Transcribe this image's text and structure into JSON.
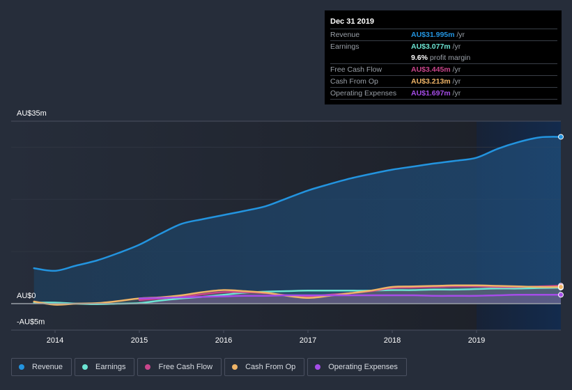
{
  "tooltip": {
    "date": "Dec 31 2019",
    "rows": [
      {
        "label": "Revenue",
        "value": "AU$31.995m",
        "unit": " /yr",
        "color": "#2394df"
      },
      {
        "label": "Earnings",
        "value": "AU$3.077m",
        "unit": " /yr",
        "color": "#6ce5d3"
      },
      {
        "label": "",
        "value": "9.6%",
        "unit": " profit margin",
        "color": "#ffffff"
      },
      {
        "label": "Free Cash Flow",
        "value": "AU$3.445m",
        "unit": " /yr",
        "color": "#c9458b"
      },
      {
        "label": "Cash From Op",
        "value": "AU$3.213m",
        "unit": " /yr",
        "color": "#efb467"
      },
      {
        "label": "Operating Expenses",
        "value": "AU$1.697m",
        "unit": " /yr",
        "color": "#a54de8"
      }
    ]
  },
  "legend": [
    {
      "label": "Revenue",
      "color": "#2394df"
    },
    {
      "label": "Earnings",
      "color": "#6ce5d3"
    },
    {
      "label": "Free Cash Flow",
      "color": "#c9458b"
    },
    {
      "label": "Cash From Op",
      "color": "#efb467"
    },
    {
      "label": "Operating Expenses",
      "color": "#a54de8"
    }
  ],
  "chart_data": {
    "type": "line",
    "title": "",
    "xlabel": "",
    "ylabel": "",
    "y_tick_labels": [
      "AU$35m",
      "AU$0",
      "-AU$5m"
    ],
    "y_ticks": [
      35,
      0,
      -5
    ],
    "ylim": [
      -5,
      35
    ],
    "x_tick_labels": [
      "2014",
      "2015",
      "2016",
      "2017",
      "2018",
      "2019"
    ],
    "x_ticks": [
      2014,
      2015,
      2016,
      2017,
      2018,
      2019
    ],
    "xlim": [
      2013.5,
      2020.0
    ],
    "grid": true,
    "highlight_from": 2019.0,
    "highlight_to": 2020.0,
    "series": [
      {
        "name": "Revenue",
        "color": "#2394df",
        "x": [
          2013.75,
          2014.0,
          2014.25,
          2014.5,
          2014.75,
          2015.0,
          2015.25,
          2015.5,
          2015.75,
          2016.0,
          2016.25,
          2016.5,
          2016.75,
          2017.0,
          2017.25,
          2017.5,
          2017.75,
          2018.0,
          2018.25,
          2018.5,
          2018.75,
          2019.0,
          2019.25,
          2019.5,
          2019.75,
          2020.0
        ],
        "values": [
          6.8,
          6.3,
          7.3,
          8.3,
          9.7,
          11.3,
          13.4,
          15.3,
          16.2,
          17.0,
          17.8,
          18.7,
          20.2,
          21.7,
          22.9,
          24.0,
          24.9,
          25.7,
          26.3,
          26.9,
          27.4,
          28.0,
          29.7,
          31.0,
          31.9,
          32.0
        ]
      },
      {
        "name": "Earnings",
        "color": "#6ce5d3",
        "x": [
          2013.75,
          2014.0,
          2014.25,
          2014.5,
          2014.75,
          2015.0,
          2015.25,
          2015.5,
          2015.75,
          2016.0,
          2016.25,
          2016.5,
          2016.75,
          2017.0,
          2017.25,
          2017.5,
          2017.75,
          2018.0,
          2018.25,
          2018.5,
          2018.75,
          2019.0,
          2019.25,
          2019.5,
          2019.75,
          2020.0
        ],
        "values": [
          0.2,
          0.2,
          0.0,
          -0.1,
          0.0,
          0.1,
          0.6,
          1.0,
          1.3,
          1.7,
          2.1,
          2.3,
          2.4,
          2.5,
          2.5,
          2.5,
          2.5,
          2.6,
          2.6,
          2.7,
          2.7,
          2.8,
          2.9,
          2.9,
          3.0,
          3.077
        ]
      },
      {
        "name": "Free Cash Flow",
        "color": "#c9458b",
        "x": [
          2015.0,
          2015.25,
          2015.5,
          2015.75,
          2016.0,
          2016.25,
          2016.5,
          2016.75,
          2017.0,
          2017.25,
          2017.5,
          2017.75,
          2018.0,
          2018.25,
          2018.5,
          2018.75,
          2019.0,
          2019.25,
          2019.5,
          2019.75,
          2020.0
        ],
        "values": [
          0.7,
          1.0,
          1.3,
          1.8,
          2.2,
          2.2,
          2.0,
          1.6,
          1.4,
          1.7,
          2.0,
          2.4,
          3.0,
          3.1,
          3.2,
          3.3,
          3.3,
          3.2,
          3.2,
          3.3,
          3.445
        ]
      },
      {
        "name": "Cash From Op",
        "color": "#efb467",
        "x": [
          2013.75,
          2014.0,
          2014.25,
          2014.5,
          2014.75,
          2015.0,
          2015.25,
          2015.5,
          2015.75,
          2016.0,
          2016.25,
          2016.5,
          2016.75,
          2017.0,
          2017.25,
          2017.5,
          2017.75,
          2018.0,
          2018.25,
          2018.5,
          2018.75,
          2019.0,
          2019.25,
          2019.5,
          2019.75,
          2020.0
        ],
        "values": [
          0.4,
          -0.2,
          0.0,
          0.1,
          0.5,
          1.0,
          1.2,
          1.6,
          2.2,
          2.6,
          2.4,
          2.1,
          1.5,
          1.1,
          1.5,
          2.0,
          2.5,
          3.2,
          3.3,
          3.4,
          3.5,
          3.5,
          3.4,
          3.3,
          3.2,
          3.213
        ]
      },
      {
        "name": "Operating Expenses",
        "color": "#a54de8",
        "x": [
          2015.0,
          2015.25,
          2015.5,
          2015.75,
          2016.0,
          2016.25,
          2016.5,
          2016.75,
          2017.0,
          2017.25,
          2017.5,
          2017.75,
          2018.0,
          2018.25,
          2018.5,
          2018.75,
          2019.0,
          2019.25,
          2019.5,
          2019.75,
          2020.0
        ],
        "values": [
          1.0,
          1.1,
          1.2,
          1.3,
          1.4,
          1.5,
          1.5,
          1.6,
          1.6,
          1.6,
          1.6,
          1.6,
          1.6,
          1.6,
          1.5,
          1.5,
          1.5,
          1.6,
          1.7,
          1.7,
          1.697
        ]
      }
    ]
  }
}
